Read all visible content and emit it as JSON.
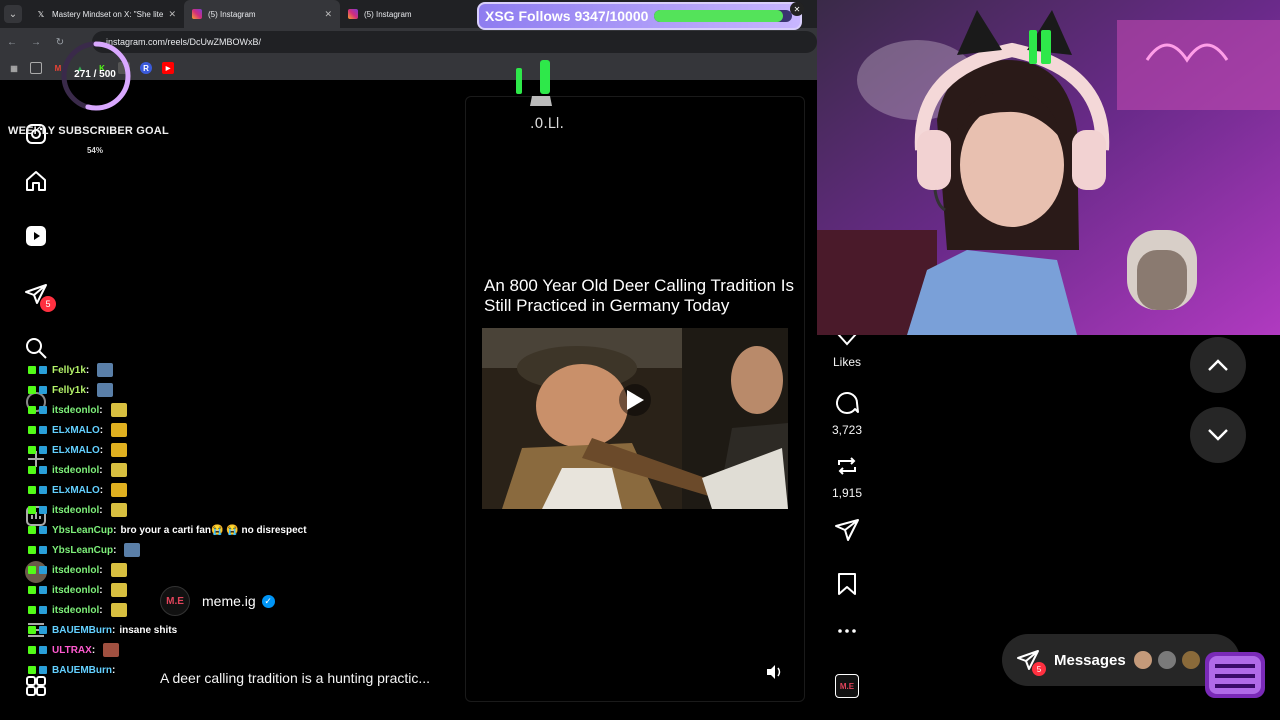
{
  "browser": {
    "tabs": [
      {
        "title": "Mastery Mindset on X: \"She lite",
        "favicon": "x-icon"
      },
      {
        "title": "(5) Instagram",
        "favicon": "instagram-icon"
      },
      {
        "title": "(5) Instagram",
        "favicon": "instagram-icon"
      }
    ],
    "url": "instagram.com/reels/DcUwZMBOWxB/"
  },
  "overlay": {
    "follows_label": "XSG Follows 9347/10000",
    "follows_progress": 0.9347,
    "sub_count": "271 / 500",
    "sub_goal_title": "WEEKLY SUBSCRIBER GOAL",
    "sub_goal_percent": "54%",
    "sub_progress": 0.54
  },
  "sidebar": {
    "notification_badge": "5"
  },
  "reel": {
    "title": "An 800 Year Old Deer Calling Tradition Is Still Practiced in Germany Today",
    "author": "meme.ig",
    "caption": "A deer calling tradition is a hunting practic...",
    "likes_label": "Likes",
    "comments": "3,723",
    "reposts": "1,915"
  },
  "messages": {
    "label": "Messages",
    "badge": "5"
  },
  "chat": [
    {
      "user": "Felly1k",
      "color": "#b4f36a",
      "text": ""
    },
    {
      "user": "Felly1k",
      "color": "#b4f36a",
      "text": ""
    },
    {
      "user": "itsdeonlol",
      "color": "#7ef07a",
      "text": ""
    },
    {
      "user": "ELxMALO",
      "color": "#63d0ff",
      "text": ""
    },
    {
      "user": "ELxMALO",
      "color": "#63d0ff",
      "text": ""
    },
    {
      "user": "itsdeonlol",
      "color": "#7ef07a",
      "text": ""
    },
    {
      "user": "ELxMALO",
      "color": "#63d0ff",
      "text": ""
    },
    {
      "user": "itsdeonlol",
      "color": "#7ef07a",
      "text": ""
    },
    {
      "user": "YbsLeanCup",
      "color": "#7ef07a",
      "text": "bro your a carti fan😭 😭 no disrespect"
    },
    {
      "user": "YbsLeanCup",
      "color": "#7ef07a",
      "text": ""
    },
    {
      "user": "itsdeonlol",
      "color": "#7ef07a",
      "text": ""
    },
    {
      "user": "itsdeonlol",
      "color": "#7ef07a",
      "text": ""
    },
    {
      "user": "itsdeonlol",
      "color": "#7ef07a",
      "text": ""
    },
    {
      "user": "BAUEMBurn",
      "color": "#63d0ff",
      "text": "insane shits"
    },
    {
      "user": "ULTRAX",
      "color": "#ff5ad0",
      "text": ""
    },
    {
      "user": "BAUEMBurn",
      "color": "#63d0ff",
      "text": ""
    }
  ],
  "colors": {
    "accent_follow_bar": "#54e35a",
    "ig_badge": "#ff3040",
    "verified": "#0095f6"
  }
}
